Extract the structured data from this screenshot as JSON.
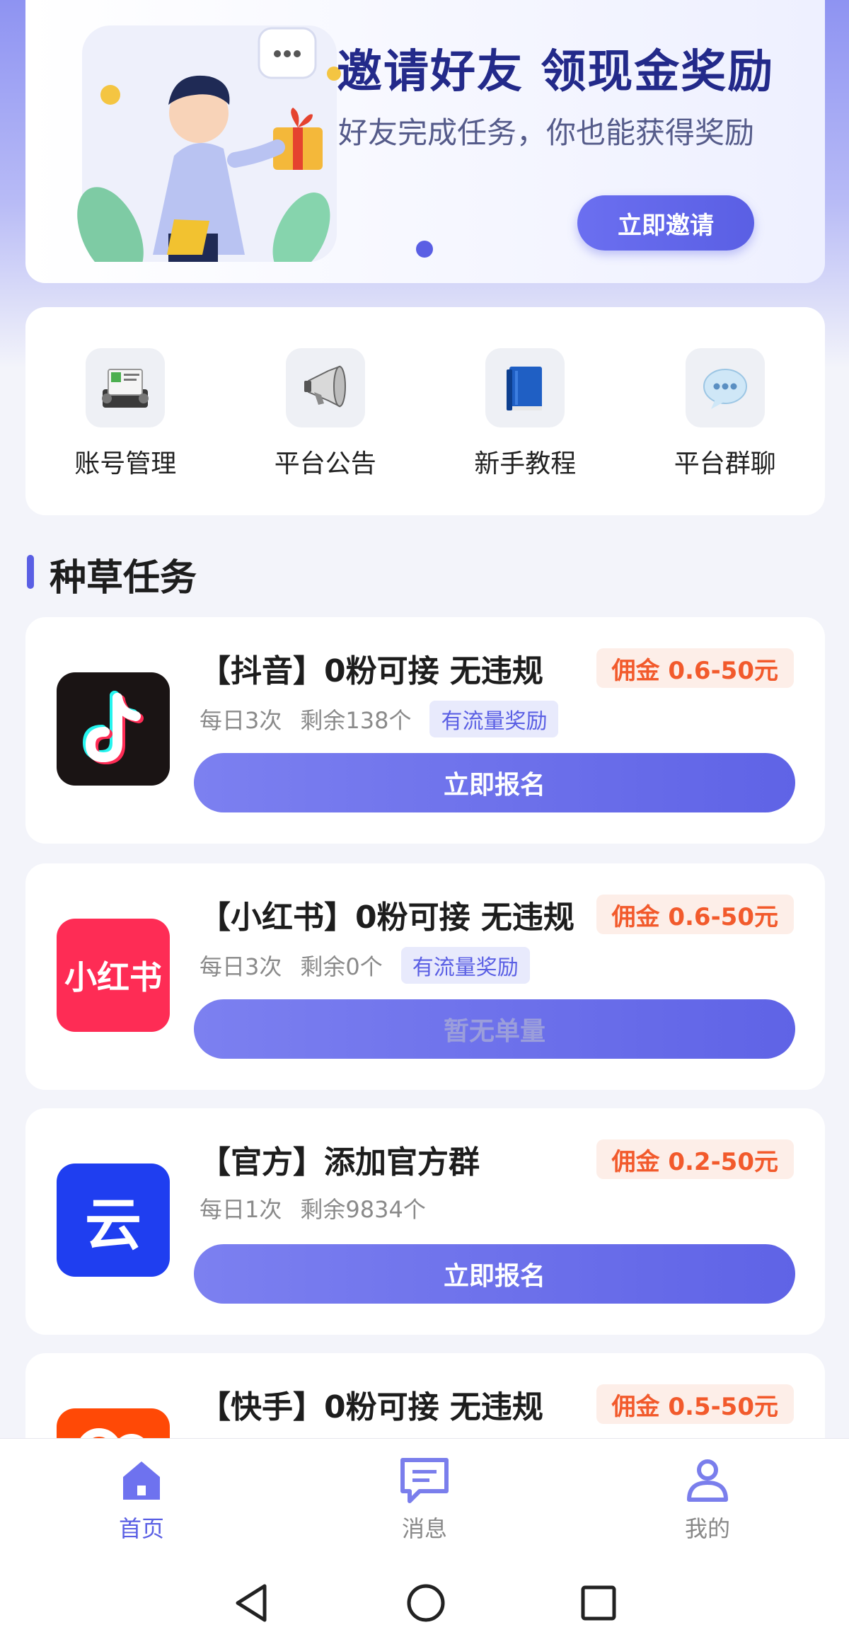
{
  "banner": {
    "title": "邀请好友 领现金奖励",
    "subtitle": "好友完成任务，你也能获得奖励",
    "button": "立即邀请"
  },
  "quick_menu": [
    {
      "label": "账号管理",
      "icon": "rolodex-icon"
    },
    {
      "label": "平台公告",
      "icon": "megaphone-icon"
    },
    {
      "label": "新手教程",
      "icon": "book-icon"
    },
    {
      "label": "平台群聊",
      "icon": "chat-bubble-icon"
    }
  ],
  "section": {
    "title": "种草任务"
  },
  "tasks": [
    {
      "logo": "douyin-logo",
      "title": "【抖音】0粉可接 无违规",
      "commission": "佣金 0.6-50元",
      "daily": "每日3次",
      "remaining": "剩余138个",
      "tag": "有流量奖励",
      "button": "立即报名"
    },
    {
      "logo": "xiaohongshu-logo",
      "logo_text": "小红书",
      "title": "【小红书】0粉可接 无违规",
      "commission": "佣金 0.6-50元",
      "daily": "每日3次",
      "remaining": "剩余0个",
      "tag": "有流量奖励",
      "button": "暂无单量"
    },
    {
      "logo": "official-yun-logo",
      "logo_text": "云",
      "title": "【官方】添加官方群",
      "commission": "佣金 0.2-50元",
      "daily": "每日1次",
      "remaining": "剩余9834个",
      "button": "立即报名"
    },
    {
      "logo": "kuaishou-logo",
      "title": "【快手】0粉可接 无违规",
      "commission": "佣金 0.5-50元"
    }
  ],
  "tabbar": [
    {
      "label": "首页",
      "icon": "home-icon",
      "active": true
    },
    {
      "label": "消息",
      "icon": "message-icon"
    },
    {
      "label": "我的",
      "icon": "user-icon"
    }
  ],
  "colors": {
    "accent": "#5a5fe4",
    "commission": "#f25a2c",
    "douyin_bg": "#1a1414",
    "xhs_bg": "#fe2c55",
    "yun_bg": "#1f3ef0",
    "kuaishou_bg": "#ff4906"
  }
}
